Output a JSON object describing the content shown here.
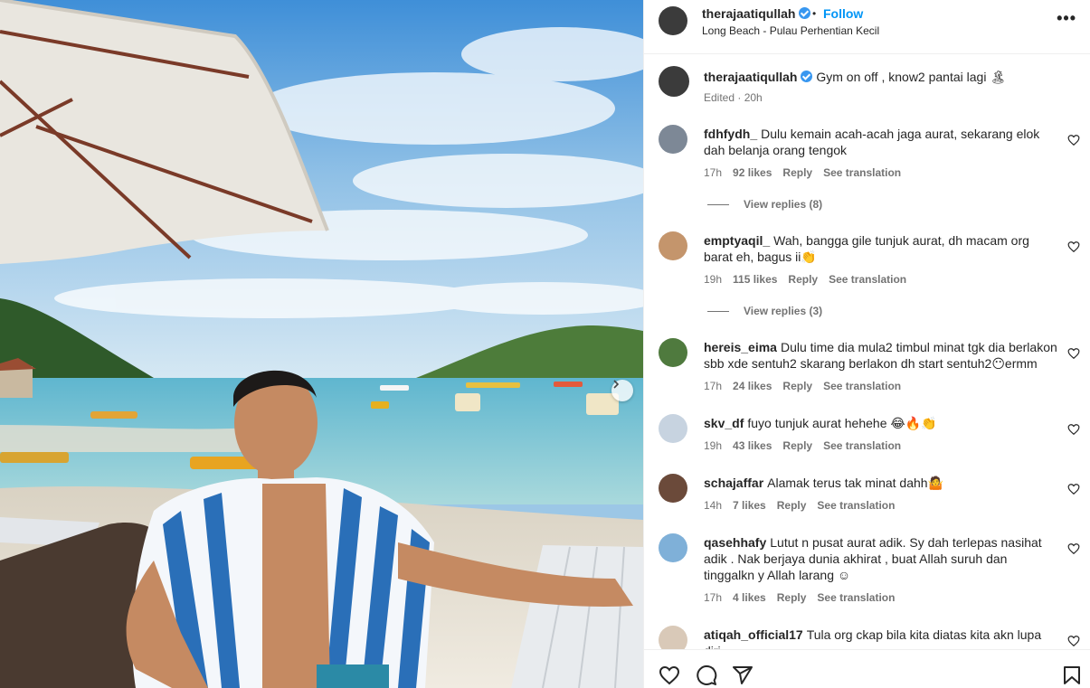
{
  "post": {
    "username": "therajaatiqullah",
    "follow_label": "Follow",
    "dot": "•",
    "location": "Long Beach - Pulau Perhentian Kecil",
    "more_label": "•••",
    "caption": "Gym on off , know2 pantai lagi 🏝",
    "edited": "Edited · 20h"
  },
  "comments": [
    {
      "user": "fdhfydh_",
      "text": "Dulu kemain acah-acah jaga aurat, sekarang elok dah belanja orang tengok",
      "time": "17h",
      "likes": "92 likes",
      "reply": "Reply",
      "translate": "See translation",
      "view_replies": "View replies (8)"
    },
    {
      "user": "emptyaqil_",
      "text": "Wah, bangga gile tunjuk aurat, dh macam org barat eh, bagus ii👏",
      "time": "19h",
      "likes": "115 likes",
      "reply": "Reply",
      "translate": "See translation",
      "view_replies": "View replies (3)"
    },
    {
      "user": "hereis_eima",
      "text": "Dulu time dia mula2 timbul minat tgk dia berlakon sbb xde sentuh2 skarang berlakon dh start sentuh2😶ermm",
      "time": "17h",
      "likes": "24 likes",
      "reply": "Reply",
      "translate": "See translation"
    },
    {
      "user": "skv_df",
      "text": "fuyo tunjuk aurat hehehe 😂🔥👏",
      "time": "19h",
      "likes": "43 likes",
      "reply": "Reply",
      "translate": "See translation"
    },
    {
      "user": "schajaffar",
      "text": "Alamak terus tak minat dahh🤷",
      "time": "14h",
      "likes": "7 likes",
      "reply": "Reply",
      "translate": "See translation"
    },
    {
      "user": "qasehhafy",
      "text": "Lutut n pusat aurat adik. Sy dah terlepas nasihat adik . Nak berjaya dunia akhirat , buat Allah suruh dan tinggalkn y Allah larang ☺",
      "time": "17h",
      "likes": "4 likes",
      "reply": "Reply",
      "translate": "See translation"
    },
    {
      "user": "atiqah_official17",
      "text": "Tula org ckap bila kita diatas kita akn lupa diri"
    }
  ],
  "colors": {
    "accent": "#0095f6",
    "verified": "#3897f0",
    "muted": "#737373"
  },
  "icons": [
    "verified-icon",
    "heart-icon",
    "comment-icon",
    "share-icon",
    "bookmark-icon",
    "chevron-right-icon"
  ]
}
